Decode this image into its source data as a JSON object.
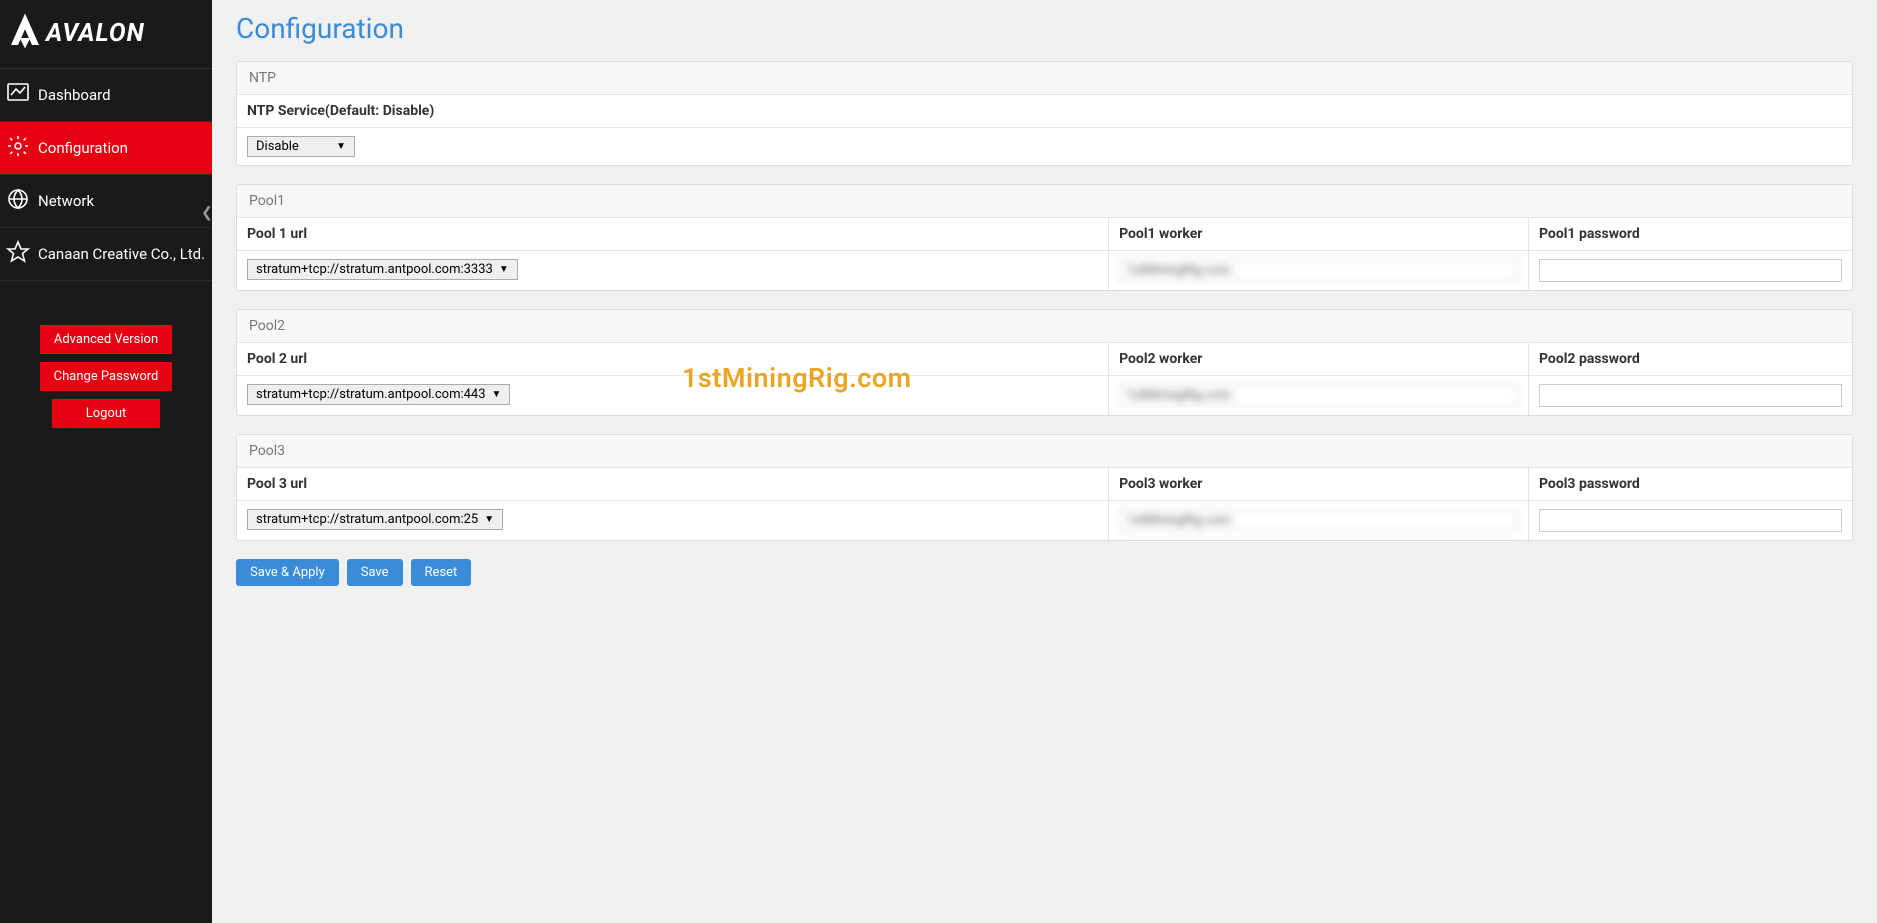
{
  "brand": {
    "name": "AVALON"
  },
  "sidebar": {
    "items": [
      {
        "label": "Dashboard",
        "icon": "chart-line-icon"
      },
      {
        "label": "Configuration",
        "icon": "gear-icon"
      },
      {
        "label": "Network",
        "icon": "globe-icon"
      },
      {
        "label": "Canaan Creative Co., Ltd.",
        "icon": "star-icon"
      }
    ],
    "buttons": {
      "advanced": "Advanced Version",
      "change_password": "Change Password",
      "logout": "Logout"
    }
  },
  "page": {
    "title": "Configuration"
  },
  "ntp": {
    "heading": "NTP",
    "service_label": "NTP Service(Default: Disable)",
    "value": "Disable"
  },
  "pools": [
    {
      "heading": "Pool1",
      "url_label": "Pool 1 url",
      "worker_label": "Pool1 worker",
      "password_label": "Pool1 password",
      "url_value": "stratum+tcp://stratum.antpool.com:3333",
      "worker_value": "1stMiningRig.com",
      "password_value": ""
    },
    {
      "heading": "Pool2",
      "url_label": "Pool 2 url",
      "worker_label": "Pool2 worker",
      "password_label": "Pool2 password",
      "url_value": "stratum+tcp://stratum.antpool.com:443",
      "worker_value": "1stMiningRig.com",
      "password_value": ""
    },
    {
      "heading": "Pool3",
      "url_label": "Pool 3 url",
      "worker_label": "Pool3 worker",
      "password_label": "Pool3 password",
      "url_value": "stratum+tcp://stratum.antpool.com:25",
      "worker_value": "1stMiningRig.com",
      "password_value": ""
    }
  ],
  "actions": {
    "save_apply": "Save & Apply",
    "save": "Save",
    "reset": "Reset"
  },
  "watermark": "1stMiningRig.com"
}
